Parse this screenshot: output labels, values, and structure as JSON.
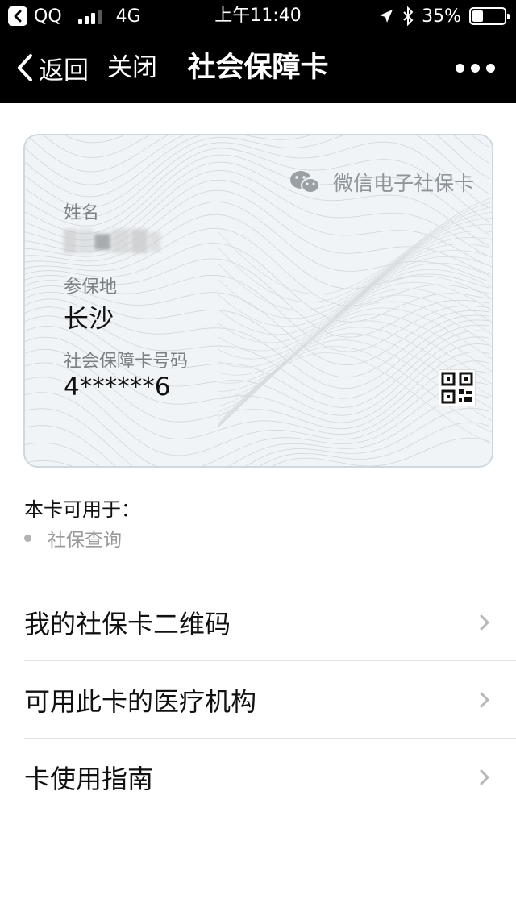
{
  "status_bar": {
    "app": "QQ",
    "network": "4G",
    "time": "上午11:40",
    "battery": "35%",
    "battery_level": 0.35
  },
  "nav": {
    "back_label": "返回",
    "close_label": "关闭",
    "title": "社会保障卡"
  },
  "card": {
    "brand": "微信电子社保卡",
    "name_label": "姓名",
    "location_label": "参保地",
    "location_value": "长沙",
    "number_label": "社会保障卡号码",
    "number_value": "4******6"
  },
  "usage": {
    "title": "本卡可用于：",
    "items": [
      "社保查询"
    ]
  },
  "menu": [
    {
      "label": "我的社保卡二维码"
    },
    {
      "label": "可用此卡的医疗机构"
    },
    {
      "label": "卡使用指南"
    }
  ],
  "colors": {
    "bar_background": "#000000",
    "card_background": "#f1f4f6",
    "card_border": "#cfd8de",
    "muted_text": "#7a8185"
  }
}
